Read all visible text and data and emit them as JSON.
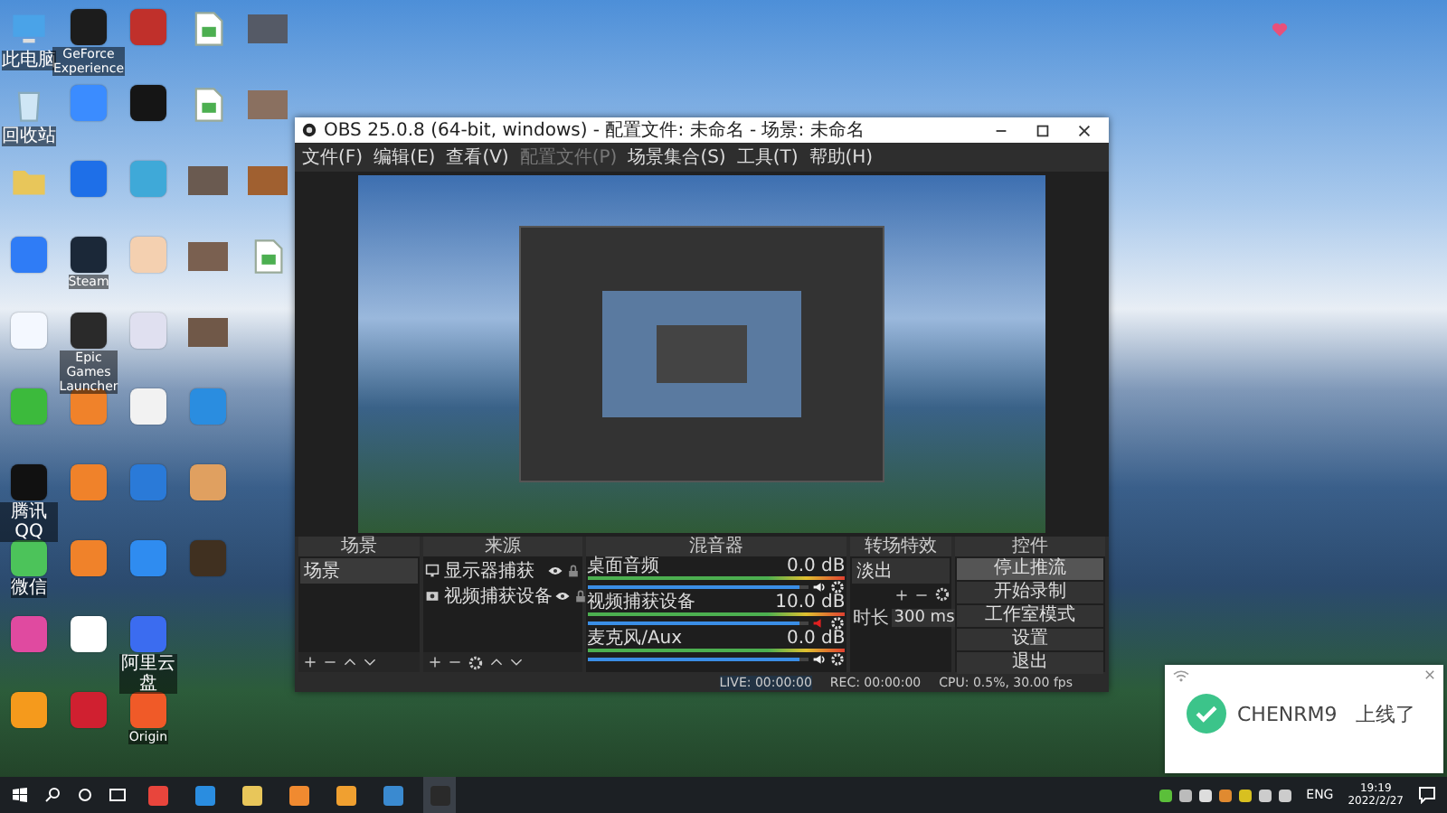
{
  "desktop": {
    "columns": [
      [
        {
          "kind": "pc",
          "color": "#4aa3e8",
          "label": "此电脑"
        },
        {
          "kind": "bin",
          "color": "#cfe6f5",
          "label": "回收站"
        },
        {
          "kind": "folder",
          "color": "#e8c65a"
        },
        {
          "kind": "app",
          "color": "#2f7cf6"
        },
        {
          "kind": "app",
          "color": "#f4f8ff"
        },
        {
          "kind": "app",
          "color": "#3cba3c"
        },
        {
          "kind": "app",
          "color": "#111111",
          "label": "腾讯QQ"
        },
        {
          "kind": "app",
          "color": "#4cc35a",
          "label": "微信"
        },
        {
          "kind": "app",
          "color": "#e04aa0"
        },
        {
          "kind": "app",
          "color": "#f59a1c"
        }
      ],
      [
        {
          "kind": "app",
          "color": "#1c1c1c",
          "label": "GeForce Experience"
        },
        {
          "kind": "app",
          "color": "#3b8cff"
        },
        {
          "kind": "app",
          "color": "#1e6fe8"
        },
        {
          "kind": "app",
          "color": "#1b2838",
          "label": "Steam"
        },
        {
          "kind": "app",
          "color": "#2a2a2a",
          "label": "Epic Games Launcher"
        },
        {
          "kind": "app",
          "color": "#f0822a"
        },
        {
          "kind": "app",
          "color": "#f0822a"
        },
        {
          "kind": "app",
          "color": "#f0822a"
        },
        {
          "kind": "app",
          "color": "#ffffff"
        },
        {
          "kind": "app",
          "color": "#d02030"
        }
      ],
      [
        {
          "kind": "app",
          "color": "#c0302b"
        },
        {
          "kind": "app",
          "color": "#151515"
        },
        {
          "kind": "app",
          "color": "#3fa9d8"
        },
        {
          "kind": "app",
          "color": "#f4d0b0"
        },
        {
          "kind": "app",
          "color": "#e0e0f0"
        },
        {
          "kind": "app",
          "color": "#f2f2f2"
        },
        {
          "kind": "app",
          "color": "#2a7ad8"
        },
        {
          "kind": "app",
          "color": "#2f8cf0"
        },
        {
          "kind": "app",
          "color": "#3b6cf0",
          "label": "阿里云盘"
        },
        {
          "kind": "app",
          "color": "#f05a28",
          "label": "Origin"
        }
      ],
      [
        {
          "kind": "file",
          "color": "#ffffff"
        },
        {
          "kind": "file",
          "color": "#ffffff"
        },
        {
          "kind": "photo",
          "color": "#6a5a50"
        },
        {
          "kind": "photo",
          "color": "#7a6050"
        },
        {
          "kind": "photo",
          "color": "#705848"
        },
        {
          "kind": "app",
          "color": "#2a8de0"
        },
        {
          "kind": "app",
          "color": "#e0a060"
        },
        {
          "kind": "app",
          "color": "#403020"
        }
      ],
      [
        {
          "kind": "photo",
          "color": "#555a66"
        },
        {
          "kind": "photo",
          "color": "#8a7060"
        },
        {
          "kind": "photo",
          "color": "#a06030"
        },
        {
          "kind": "file",
          "color": "#ffffff"
        }
      ]
    ]
  },
  "obs": {
    "title": "OBS 25.0.8 (64-bit, windows) - 配置文件: 未命名 - 场景: 未命名",
    "menu": [
      {
        "label": "文件(F)",
        "disabled": false
      },
      {
        "label": "编辑(E)",
        "disabled": false
      },
      {
        "label": "查看(V)",
        "disabled": false
      },
      {
        "label": "配置文件(P)",
        "disabled": true
      },
      {
        "label": "场景集合(S)",
        "disabled": false
      },
      {
        "label": "工具(T)",
        "disabled": false
      },
      {
        "label": "帮助(H)",
        "disabled": false
      }
    ],
    "docks": {
      "scenes": {
        "title": "场景",
        "items": [
          {
            "label": "场景",
            "selected": true
          }
        ]
      },
      "sources": {
        "title": "来源",
        "items": [
          {
            "kind": "monitor",
            "label": "显示器捕获",
            "visible": true,
            "locked": false
          },
          {
            "kind": "camera",
            "label": "视频捕获设备",
            "visible": true,
            "locked": false
          }
        ]
      },
      "mixer": {
        "title": "混音器",
        "channels": [
          {
            "name": "桌面音频",
            "reading": "0.0 dB",
            "level": 0.96,
            "muted": false
          },
          {
            "name": "视频捕获设备",
            "reading": "10.0 dB",
            "level": 0.96,
            "muted": true
          },
          {
            "name": "麦克风/Aux",
            "reading": "0.0 dB",
            "level": 0.96,
            "muted": false
          }
        ]
      },
      "transitions": {
        "title": "转场特效",
        "type": "淡出",
        "duration_label": "时长",
        "duration": "300 ms"
      },
      "controls": {
        "title": "控件",
        "buttons": [
          {
            "label": "停止推流",
            "selected": true
          },
          {
            "label": "开始录制",
            "selected": false
          },
          {
            "label": "工作室模式",
            "selected": false
          },
          {
            "label": "设置",
            "selected": false
          },
          {
            "label": "退出",
            "selected": false
          }
        ]
      }
    },
    "status": {
      "live": "LIVE: 00:00:00",
      "rec": "REC: 00:00:00",
      "cpu": "CPU: 0.5%, 30.00 fps"
    }
  },
  "notification": {
    "name": "CHENRM9",
    "message": "上线了"
  },
  "taskbar": {
    "apps": [
      {
        "color": "#e8453c",
        "selected": false
      },
      {
        "color": "#2a8de0",
        "selected": false
      },
      {
        "color": "#e8c65a",
        "selected": false
      },
      {
        "color": "#f08a30",
        "selected": false
      },
      {
        "color": "#f0a030",
        "selected": false
      },
      {
        "color": "#3a8ad0",
        "selected": false
      },
      {
        "color": "#2a2a2a",
        "selected": true
      }
    ],
    "language": "ENG",
    "time": "19:19",
    "date": "2022/2/27"
  }
}
